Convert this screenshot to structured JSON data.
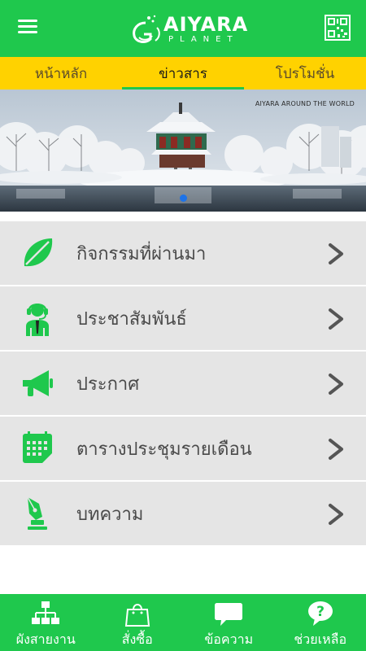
{
  "header": {
    "menu_icon": "hamburger-icon",
    "logo_text": "AIYARA",
    "logo_subtext": "PLANET",
    "qr_icon": "qr-code-icon",
    "color": "#1fc84d"
  },
  "tabs": [
    {
      "label": "หน้าหลัก",
      "active": false
    },
    {
      "label": "ข่าวสาร",
      "active": true
    },
    {
      "label": "โปรโมชั่น",
      "active": false
    }
  ],
  "tab_bar_color": "#ffd200",
  "banner": {
    "caption": "AIYARA AROUND THE WORLD",
    "slide_count": 1,
    "active_slide": 1
  },
  "menu": [
    {
      "label": "กิจกรรมที่ผ่านมา",
      "icon": "leaf-icon"
    },
    {
      "label": "ประชาสัมพันธ์",
      "icon": "headset-person-icon"
    },
    {
      "label": "ประกาศ",
      "icon": "megaphone-icon"
    },
    {
      "label": "ตารางประชุมรายเดือน",
      "icon": "calendar-icon"
    },
    {
      "label": "บทความ",
      "icon": "pen-nib-icon"
    }
  ],
  "bottom_nav": [
    {
      "label": "ผังสายงาน",
      "icon": "org-chart-icon"
    },
    {
      "label": "สั่งซื้อ",
      "icon": "shopping-bag-icon"
    },
    {
      "label": "ข้อความ",
      "icon": "chat-bubble-icon"
    },
    {
      "label": "ช่วยเหลือ",
      "icon": "help-icon"
    }
  ],
  "accent_green": "#1fc84d",
  "row_bg": "#e5e5e5"
}
